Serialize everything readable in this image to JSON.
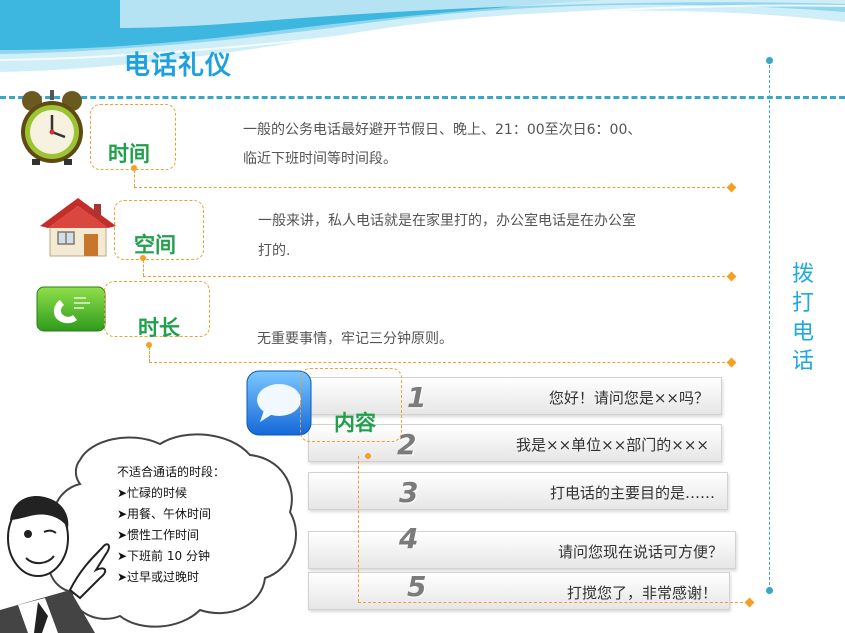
{
  "header": {
    "title": "电话礼仪"
  },
  "side": {
    "text": "拨打电话"
  },
  "rules": [
    {
      "label": "时间",
      "icon": "alarm-clock-icon",
      "desc_line1": "一般的公务电话最好避开节假日、晚上、21：00至次日6：00、",
      "desc_line2": "临近下班时间等时间段。"
    },
    {
      "label": "空间",
      "icon": "house-icon",
      "desc_line1": "一般来讲，私人电话就是在家里打的，办公室电话是在办公室",
      "desc_line2": "打的."
    },
    {
      "label": "时长",
      "icon": "phone-icon",
      "desc_line1": "无重要事情，牢记三分钟原则。"
    },
    {
      "label": "内容",
      "icon": "chat-bubble-icon"
    }
  ],
  "steps": [
    {
      "num": "1",
      "text": "您好！请问您是××吗？"
    },
    {
      "num": "2",
      "text": "我是××单位××部门的×××"
    },
    {
      "num": "3",
      "text": "打电话的主要目的是……"
    },
    {
      "num": "4",
      "text": "请问您现在说话可方便？"
    },
    {
      "num": "5",
      "text": "打搅您了，非常感谢！"
    }
  ],
  "cloud": {
    "heading": "不适合通话的时段：",
    "items": [
      "➤忙碌的时候",
      "➤用餐、午休时间",
      "➤惯性工作时间",
      "➤下班前 10 分钟",
      "➤过早或过晚时"
    ]
  },
  "colors": {
    "accent_blue": "#1ea0df",
    "label_green": "#21a04c",
    "dash_orange": "#f0a030",
    "line_blue": "#3aa6c7"
  }
}
